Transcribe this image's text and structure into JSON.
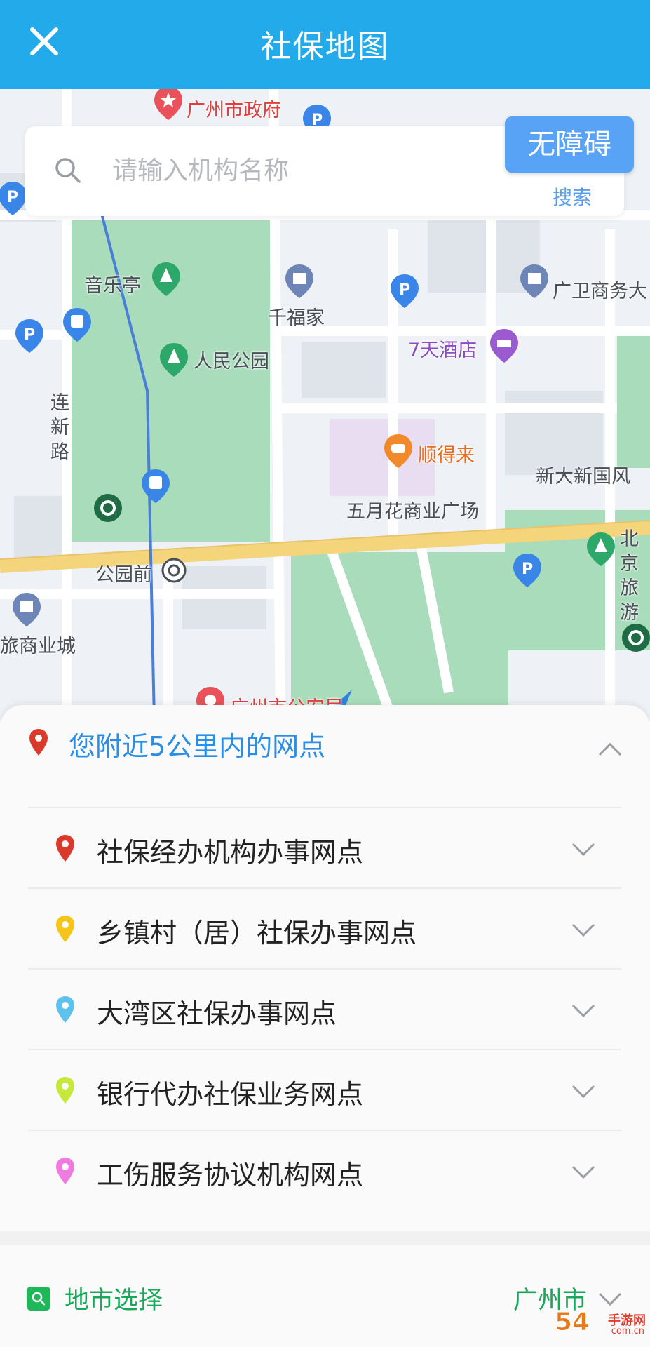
{
  "header": {
    "title": "社保地图",
    "close_icon": "close-icon"
  },
  "search": {
    "placeholder": "请输入机构名称",
    "search_button": "搜索",
    "accessible_button": "无障碍"
  },
  "map": {
    "labels": [
      {
        "id": "gov",
        "text": "广州市政府"
      },
      {
        "id": "music",
        "text": "音乐亭"
      },
      {
        "id": "qianfu",
        "text": "千福家"
      },
      {
        "id": "guangwei",
        "text": "广卫商务大"
      },
      {
        "id": "park",
        "text": "人民公园"
      },
      {
        "id": "seven",
        "text": "7天酒店"
      },
      {
        "id": "lianxin",
        "text": "连新路"
      },
      {
        "id": "shundelai",
        "text": "顺得来"
      },
      {
        "id": "xinda",
        "text": "新大新国风"
      },
      {
        "id": "mayflower",
        "text": "五月花商业广场"
      },
      {
        "id": "beijing",
        "text": "北京旅游"
      },
      {
        "id": "gongyuanqian",
        "text": "公园前"
      },
      {
        "id": "mall",
        "text": "旅商业城"
      },
      {
        "id": "police",
        "text": "广州市公安局"
      }
    ],
    "colors": {
      "park": "#8fd3a8",
      "road_main": "#f4d57b",
      "road_minor": "#ffffff",
      "building": "#dfe3ea",
      "rail": "#4a7fd8"
    }
  },
  "nearby": {
    "title": "您附近5公里内的网点",
    "expanded": true,
    "categories": [
      {
        "label": "社保经办机构办事网点",
        "color": "#d93a2b"
      },
      {
        "label": "乡镇村（居）社保办事网点",
        "color": "#f5c518"
      },
      {
        "label": "大湾区社保办事网点",
        "color": "#5ec3ec"
      },
      {
        "label": "银行代办社保业务网点",
        "color": "#c6e83a"
      },
      {
        "label": "工伤服务协议机构网点",
        "color": "#ef7ae0"
      }
    ]
  },
  "city_select": {
    "label": "地市选择",
    "value": "广州市"
  },
  "watermark": {
    "big": "54",
    "small": "手游网",
    "url": "com.cn"
  }
}
